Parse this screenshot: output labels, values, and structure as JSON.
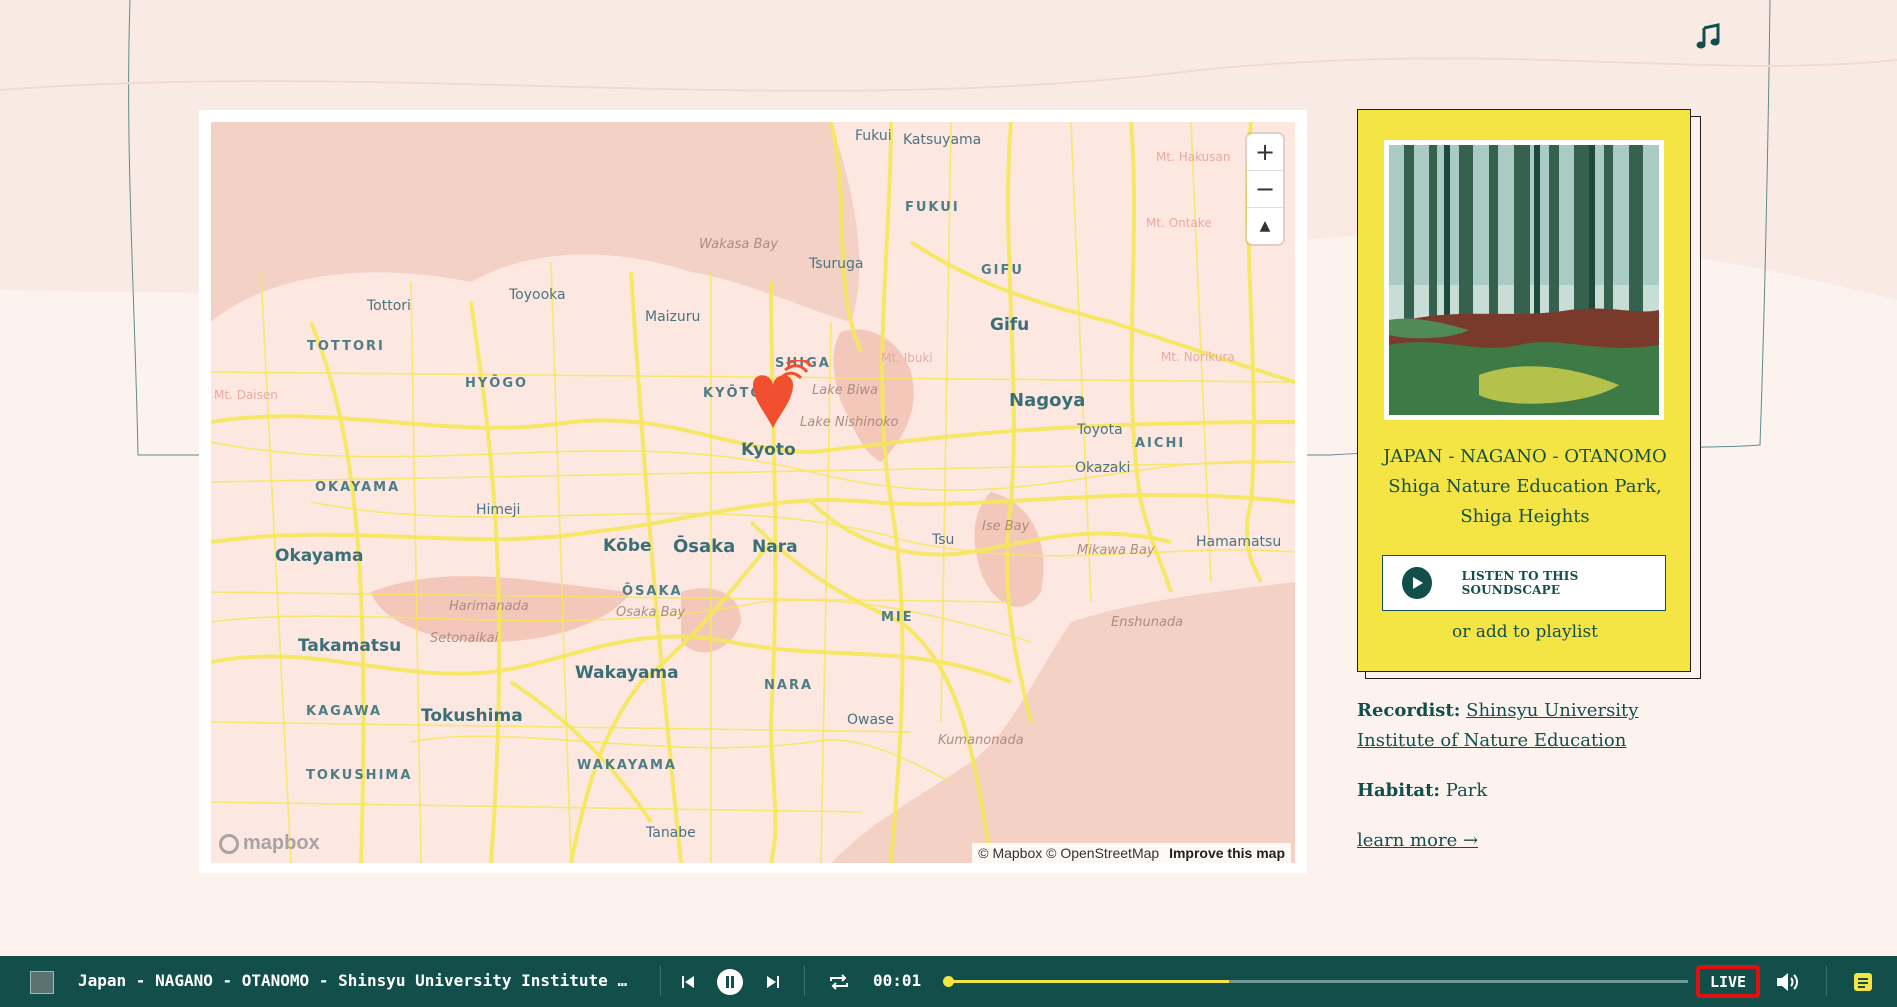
{
  "header": {
    "music_icon": "music-note-icon"
  },
  "map": {
    "labels": {
      "fukui_city": "Fukui",
      "katsuyama": "Katsuyama",
      "fukui_pref": "FUKUI",
      "wakasa_bay": "Wakasa Bay",
      "tsuruga": "Tsuruga",
      "gifu_pref": "GIFU",
      "gifu_city": "Gifu",
      "maizuru": "Maizuru",
      "toyooka": "Toyooka",
      "tottori_city": "Tottori",
      "tottori_pref": "TOTTORI",
      "hyogo": "HYŌGO",
      "kyoto_pref": "KYŌTO",
      "shiga": "SHIGA",
      "lake_biwa": "Lake Biwa",
      "lake_nishinoko": "Lake Nishinoko",
      "kyoto": "Kyoto",
      "nagoya": "Nagoya",
      "toyota": "Toyota",
      "aichi": "AICHI",
      "okazaki": "Okazaki",
      "okayama_pref": "OKAYAMA",
      "himeji": "Himeji",
      "okayama": "Okayama",
      "kobe": "Kōbe",
      "osaka": "Ōsaka",
      "nara": "Nara",
      "osaka_pref": "ŌSAKA",
      "osaka_bay": "Osaka Bay",
      "tsu": "Tsu",
      "ise_bay": "Ise Bay",
      "mikawa_bay": "Mikawa Bay",
      "hamamatsu": "Hamamatsu",
      "harimanada": "Harimanada",
      "setonaikai": "Setonaikai",
      "mie": "MIE",
      "enshunada": "Enshunada",
      "takamatsu": "Takamatsu",
      "wakayama": "Wakayama",
      "nara_pref": "NARA",
      "kagawa": "KAGAWA",
      "tokushima": "Tokushima",
      "owase": "Owase",
      "kumanonada": "Kumanonada",
      "tokushima_pref": "TOKUSHIMA",
      "wakayama_pref": "WAKAYAMA",
      "tanabe": "Tanabe",
      "mt_haku": "Mt. Hakusan",
      "mt_ontake": "Mt. Ontake",
      "mt_ibuki": "Mt. Ibuki",
      "mt_daisen": "Mt. Daisen",
      "mt_norikura": "Mt. Norikura"
    },
    "zoom_in": "+",
    "zoom_out": "−",
    "compass": "▲",
    "logo": "mapbox",
    "attribution": "© Mapbox © OpenStreetMap",
    "improve": "Improve this map",
    "marker_color": "#f0502f"
  },
  "card": {
    "location_line1": "JAPAN - NAGANO - OTANOMO",
    "location_line2": "Shiga Nature Education Park,",
    "location_line3": "Shiga Heights",
    "listen_label": "LISTEN TO THIS SOUNDSCAPE",
    "playlist": "or add to playlist"
  },
  "meta": {
    "recordist_label": "Recordist:",
    "recordist_value": "Shinsyu University Institute of Nature Education",
    "habitat_label": "Habitat:",
    "habitat_value": "Park",
    "learn_more": "learn more →"
  },
  "player": {
    "track_title": "Japan - NAGANO - OTANOMO - Shinsyu University Institute of Nature Education",
    "time": "00:01",
    "progress": 0.38,
    "live": "LIVE"
  },
  "colors": {
    "brand": "#124f4a",
    "accent": "#f4e545",
    "live_border": "#e01010"
  }
}
